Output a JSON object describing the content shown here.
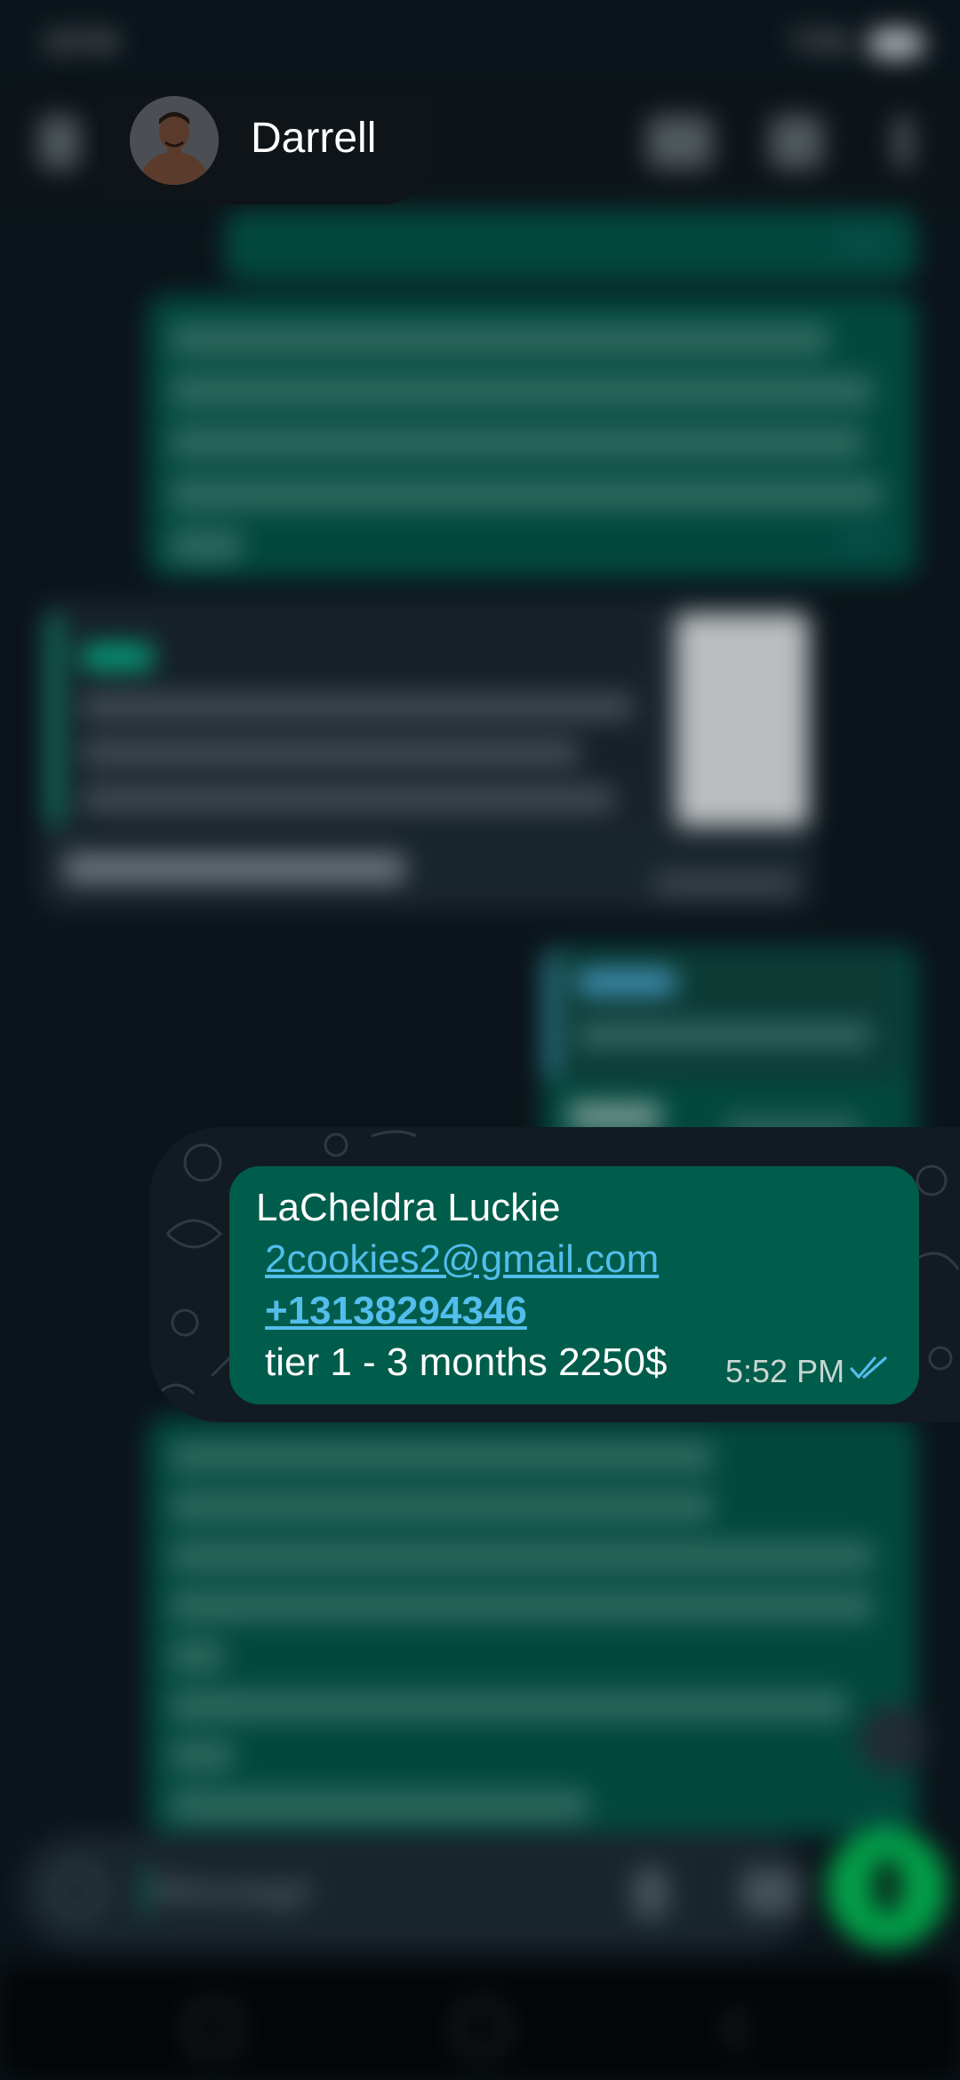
{
  "statusbar": {
    "time": "10:04",
    "right": "71%"
  },
  "chat": {
    "contact_name": "Darrell",
    "focused_message": {
      "name_line": "LaCheldra Luckie",
      "email": "2cookies2@gmail.com",
      "phone": "+13138294346",
      "details": "tier 1 - 3 months 2250$",
      "time": "5:52 PM",
      "status": "read"
    }
  },
  "input": {
    "placeholder": "Message"
  },
  "colors": {
    "background": "#0b141a",
    "outgoing_bubble": "#005c4b",
    "incoming_bubble": "#1f2c34",
    "link": "#53bdeb",
    "read_ticks": "#53bdeb",
    "mic_button": "#00d65c"
  },
  "icons": [
    "back-arrow-icon",
    "video-call-icon",
    "phone-icon",
    "more-vert-icon",
    "emoji-icon",
    "attach-icon",
    "camera-icon",
    "mic-icon",
    "double-check-icon",
    "scroll-down-icon",
    "nav-recents-icon",
    "nav-home-icon",
    "nav-back-icon"
  ]
}
